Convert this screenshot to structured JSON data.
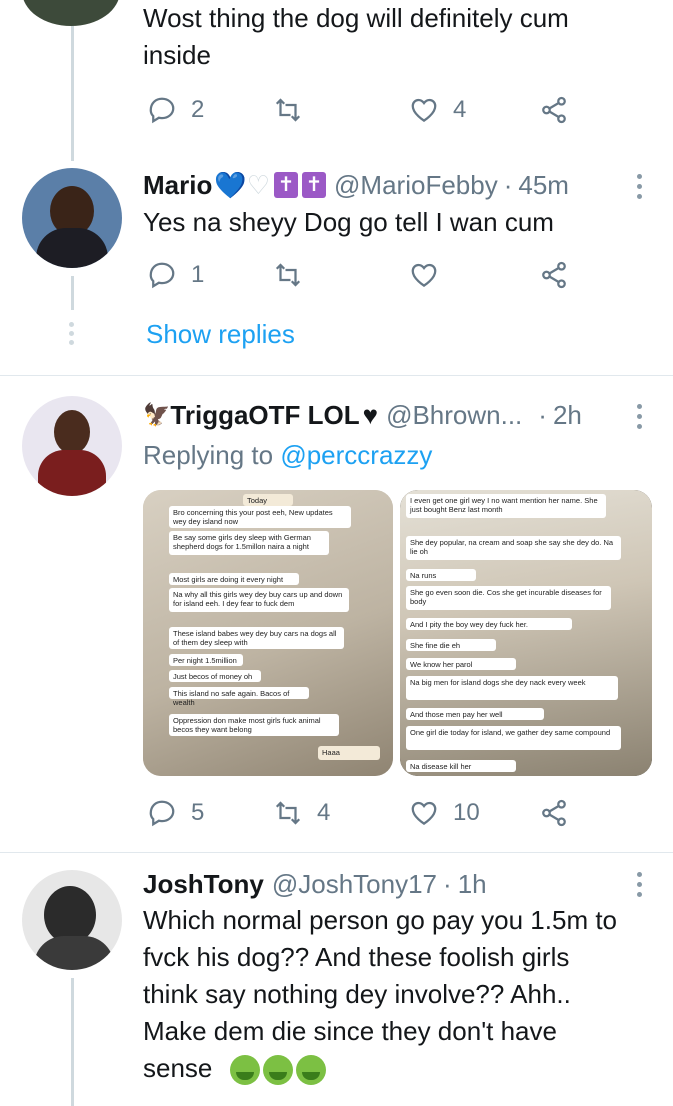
{
  "tweet0": {
    "text_line1": "Wost thing the dog will definitely cum",
    "text_line2": "inside",
    "replies": "2",
    "retweets": "",
    "likes": "4"
  },
  "tweet1": {
    "name": "Mario",
    "handle": "@MarioFebby",
    "time": "45m",
    "badge_cross": "✝",
    "text": "Yes na sheyy Dog go tell I wan cum",
    "replies": "1",
    "retweets": "",
    "likes": ""
  },
  "show_replies": "Show replies",
  "tweet2": {
    "name": "TriggaOTF LOL",
    "handle": "@Bhrown...",
    "time": "2h",
    "replying_prefix": "Replying to ",
    "replying_to": "@perccrazzy",
    "replies": "5",
    "retweets": "4",
    "likes": "10",
    "chat_left": [
      "Today",
      "Bro concerning this your post eeh, New updates wey dey island now",
      "Be say some girls dey sleep with German shepherd dogs for 1.5millon naira a night",
      "Most girls are doing it every night",
      "Na why all this girls wey dey buy cars up and down for island eeh. I dey fear to fuck dem",
      "These island babes wey dey buy cars na dogs all of them dey sleep with",
      "Per night 1.5million",
      "Just becos of money oh",
      "This island no safe again. Bacos of wealth",
      "Oppression don make most girls fuck animal becos they want belong",
      "Haaa"
    ],
    "chat_right": [
      "I even get one girl wey I no want mention her name. She just bought Benz last month",
      "She dey popular, na cream and soap she say she dey do. Na lie oh",
      "Na runs",
      "She go even soon die. Cos she get incurable diseases for body",
      "And I pity the boy wey dey fuck her.",
      "She fine die eh",
      "We know her parol",
      "Na big men for island dogs she dey nack every week",
      "And those men pay her well",
      "One girl die today for island, we gather dey same compound",
      "Na disease kill her"
    ]
  },
  "tweet3": {
    "name": "JoshTony",
    "handle": "@JoshTony17",
    "time": "1h",
    "text_line1": "Which normal person go pay you 1.5m to",
    "text_line2": "fvck his dog?? And these foolish girls",
    "text_line3": "think say nothing dey involve?? Ahh..",
    "text_line4": "Make dem die since they don't have",
    "text_line5": "sense"
  },
  "dot": "·",
  "colors": {
    "accent": "#1da1f2",
    "muted": "#657786",
    "line": "#cfd9de"
  },
  "icons": [
    "reply-icon",
    "retweet-icon",
    "like-icon",
    "share-icon",
    "more-icon",
    "blue-heart-icon",
    "white-heart-icon",
    "black-heart-icon",
    "eagle-icon",
    "vomit-face-icon"
  ]
}
